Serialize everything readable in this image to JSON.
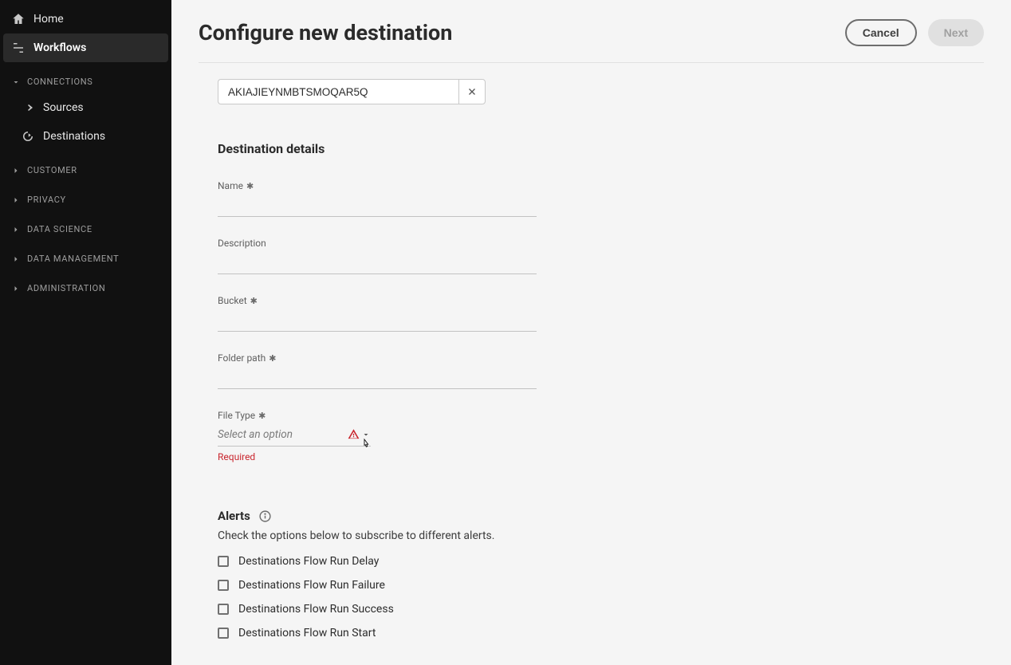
{
  "sidebar": {
    "home_label": "Home",
    "workflows_label": "Workflows",
    "sections": {
      "connections": {
        "label": "CONNECTIONS",
        "sources_label": "Sources",
        "destinations_label": "Destinations"
      },
      "customer": "CUSTOMER",
      "privacy": "PRIVACY",
      "data_science": "DATA SCIENCE",
      "data_management": "DATA MANAGEMENT",
      "administration": "ADMINISTRATION"
    }
  },
  "header": {
    "title": "Configure new destination",
    "cancel_label": "Cancel",
    "next_label": "Next"
  },
  "top_input": {
    "value": "AKIAJIEYNMBTSMOQAR5Q"
  },
  "details": {
    "heading": "Destination details",
    "name_label": "Name",
    "description_label": "Description",
    "bucket_label": "Bucket",
    "folder_label": "Folder path",
    "filetype_label": "File Type",
    "filetype_placeholder": "Select an option",
    "filetype_error": "Required"
  },
  "alerts": {
    "title": "Alerts",
    "description": "Check the options below to subscribe to different alerts.",
    "options": [
      "Destinations Flow Run Delay",
      "Destinations Flow Run Failure",
      "Destinations Flow Run Success",
      "Destinations Flow Run Start"
    ]
  }
}
